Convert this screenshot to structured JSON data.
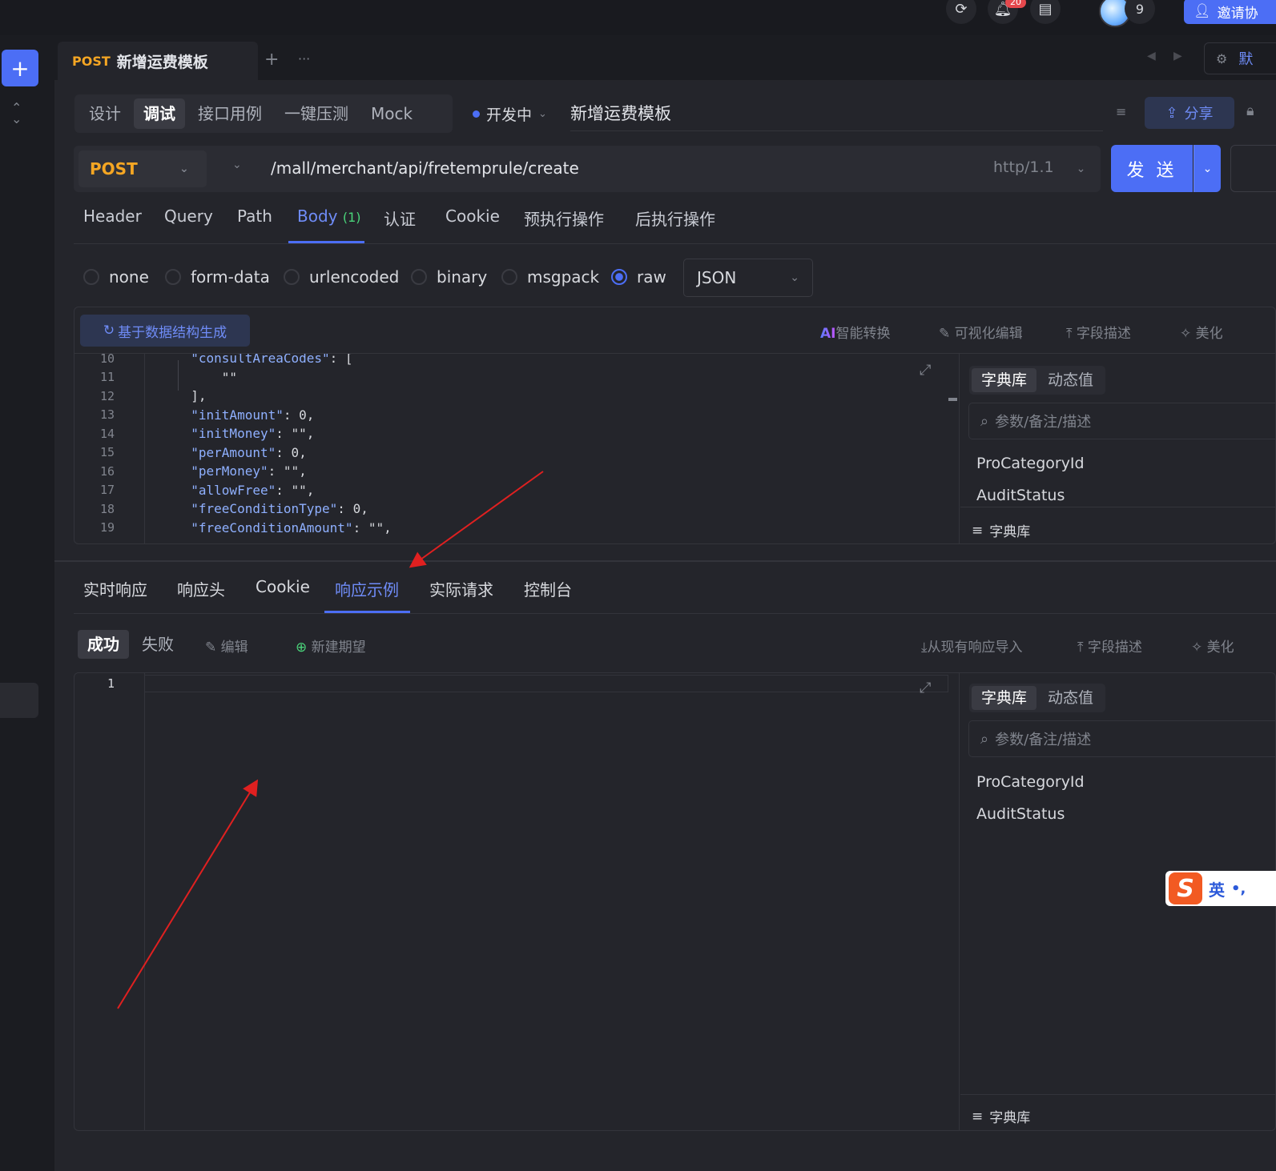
{
  "topbar": {
    "notification_count": "20",
    "user_count": "9",
    "invite_label": "邀请协"
  },
  "tabbar": {
    "method": "POST",
    "title": "新增运费模板",
    "add": "+",
    "more": "···",
    "right_label": "默"
  },
  "mode_tabs": [
    "设计",
    "调试",
    "接口用例",
    "一键压测",
    "Mock"
  ],
  "mode_active": "调试",
  "status": "开发中",
  "api_name": "新增运费模板",
  "share_label": "分享",
  "request": {
    "method": "POST",
    "url": "/mall/merchant/api/fretemprule/create",
    "protocol": "http/1.1",
    "send_label": "发 送"
  },
  "req_tabs": {
    "header": "Header",
    "query": "Query",
    "path": "Path",
    "body": "Body",
    "body_count": "(1)",
    "auth": "认证",
    "cookie": "Cookie",
    "pre": "预执行操作",
    "post": "后执行操作"
  },
  "body_types": {
    "none": "none",
    "form_data": "form-data",
    "urlencoded": "urlencoded",
    "binary": "binary",
    "msgpack": "msgpack",
    "raw": "raw",
    "selected": "raw",
    "format": "JSON"
  },
  "editor_tools": {
    "generate": "基于数据结构生成",
    "ai_prefix": "AI",
    "ai": "智能转换",
    "visual": "可视化编辑",
    "field_desc": "字段描述",
    "beautify": "美化"
  },
  "code_lines": [
    {
      "n": "10",
      "t": "  \"consultAreaCodes\": ["
    },
    {
      "n": "11",
      "t": "      \"\""
    },
    {
      "n": "12",
      "t": "  ],"
    },
    {
      "n": "13",
      "t": "  \"initAmount\": 0,"
    },
    {
      "n": "14",
      "t": "  \"initMoney\": \"\","
    },
    {
      "n": "15",
      "t": "  \"perAmount\": 0,"
    },
    {
      "n": "16",
      "t": "  \"perMoney\": \"\","
    },
    {
      "n": "17",
      "t": "  \"allowFree\": \"\","
    },
    {
      "n": "18",
      "t": "  \"freeConditionType\": 0,"
    },
    {
      "n": "19",
      "t": "  \"freeConditionAmount\": \"\","
    }
  ],
  "side_top": {
    "seg_dict": "字典库",
    "seg_dynamic": "动态值",
    "search_placeholder": "参数/备注/描述",
    "items": [
      "ProCategoryId",
      "AuditStatus"
    ],
    "footer": "字典库"
  },
  "resp_tabs": {
    "realtime": "实时响应",
    "headers": "响应头",
    "cookie": "Cookie",
    "example": "响应示例",
    "actual": "实际请求",
    "console": "控制台"
  },
  "resp_tools": {
    "success": "成功",
    "fail": "失败",
    "edit": "编辑",
    "new_expect": "新建期望",
    "import": "从现有响应导入",
    "field_desc": "字段描述",
    "beautify": "美化",
    "line_no": "1"
  },
  "side_bottom": {
    "seg_dict": "字典库",
    "seg_dynamic": "动态值",
    "search_placeholder": "参数/备注/描述",
    "items": [
      "ProCategoryId",
      "AuditStatus"
    ],
    "footer": "字典库"
  },
  "ime": {
    "label": "英"
  },
  "colors": {
    "accent": "#4c6ef5",
    "post": "#f5a623",
    "arrow": "#e02020"
  }
}
